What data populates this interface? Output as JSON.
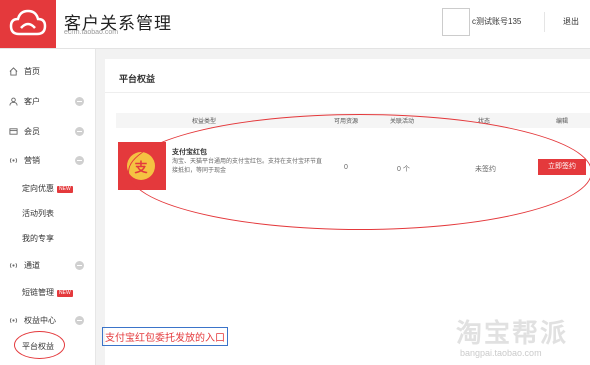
{
  "header": {
    "title": "客户关系管理",
    "subtitle": "ecrm.taobao.com",
    "user_name": "c测试账号135",
    "logout": "退出"
  },
  "sidebar": {
    "items": [
      {
        "label": "首页",
        "icon": "home-icon",
        "type": "top"
      },
      {
        "label": "客户",
        "icon": "user-icon",
        "type": "top",
        "collapse": true
      },
      {
        "label": "会员",
        "icon": "card-icon",
        "type": "top",
        "collapse": true
      },
      {
        "label": "营销",
        "icon": "broadcast-icon",
        "type": "top",
        "collapse": true
      },
      {
        "label": "定向优惠",
        "badge": "NEW",
        "type": "sub"
      },
      {
        "label": "活动列表",
        "type": "sub"
      },
      {
        "label": "我的专享",
        "type": "sub"
      },
      {
        "label": "通道",
        "icon": "broadcast-icon",
        "type": "top",
        "collapse": true
      },
      {
        "label": "短链管理",
        "badge": "NEW",
        "type": "sub"
      },
      {
        "label": "权益中心",
        "icon": "broadcast-icon",
        "type": "top",
        "collapse": true
      },
      {
        "label": "平台权益",
        "type": "sub",
        "selected": true
      }
    ]
  },
  "main": {
    "title": "平台权益",
    "columns": [
      "权益类型",
      "可用资源",
      "关联活动",
      "状态",
      "编辑"
    ],
    "rows": [
      {
        "name": "支付宝红包",
        "icon_char": "支",
        "description": "淘宝、天猫平台通用的支付宝红包。支持在支付宝环节直接抵扣，等同于现金",
        "available": "0",
        "linked": "0 个",
        "status": "未签约",
        "action": "立即签约"
      }
    ]
  },
  "annotation": "支付宝红包委托发放的入口",
  "watermark": {
    "text": "淘宝帮派",
    "url": "bangpai.taobao.com"
  },
  "colors": {
    "accent": "#e4393c",
    "annotation_border": "#3b74c9",
    "coin": "#f5c242"
  }
}
